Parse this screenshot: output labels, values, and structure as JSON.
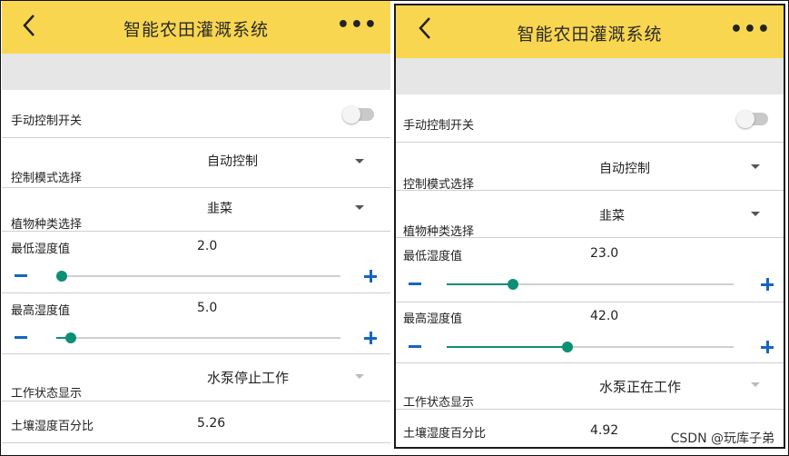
{
  "screens": [
    {
      "title": "智能农田灌溉系统",
      "manual_label": "手动控制开关",
      "mode_label": "控制模式选择",
      "mode_value": "自动控制",
      "plant_label": "植物种类选择",
      "plant_value": "韭菜",
      "min_label": "最低湿度值",
      "min_value": "2.0",
      "min_fraction": 0.02,
      "max_label": "最高湿度值",
      "max_value": "5.0",
      "max_fraction": 0.05,
      "status_label": "工作状态显示",
      "status_value": "水泵停止工作",
      "soil_label": "土壤湿度百分比",
      "soil_value": "5.26"
    },
    {
      "title": "智能农田灌溉系统",
      "manual_label": "手动控制开关",
      "mode_label": "控制模式选择",
      "mode_value": "自动控制",
      "plant_label": "植物种类选择",
      "plant_value": "韭菜",
      "min_label": "最低湿度值",
      "min_value": "23.0",
      "min_fraction": 0.23,
      "max_label": "最高湿度值",
      "max_value": "42.0",
      "max_fraction": 0.42,
      "status_label": "工作状态显示",
      "status_value": "水泵正在工作",
      "soil_label": "土壤湿度百分比",
      "soil_value": "4.92"
    }
  ],
  "watermark": "CSDN @玩库子弟",
  "icons": {
    "back": "back-arrow-icon",
    "more": "more-dots-icon",
    "dropdown": "chevron-down-icon",
    "minus": "minus-icon",
    "plus": "plus-icon"
  },
  "colors": {
    "appbar": "#f9d64f",
    "slider": "#0d8f73",
    "stepper": "#1565c0"
  }
}
